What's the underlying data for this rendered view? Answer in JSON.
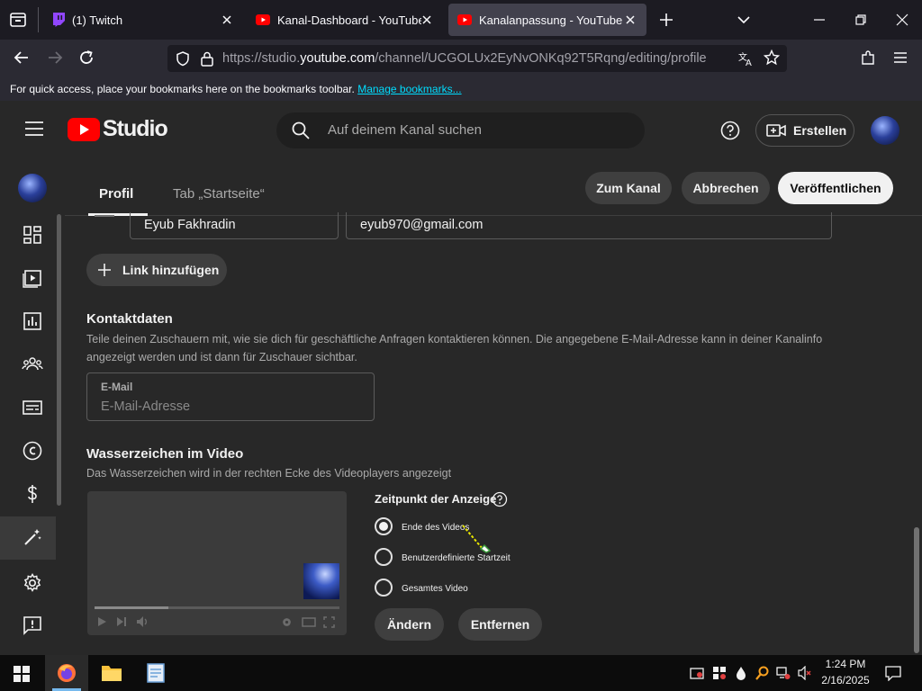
{
  "browser": {
    "tabs": [
      {
        "title": "(1) Twitch",
        "favicon": "twitch-icon",
        "active": false
      },
      {
        "title": "Kanal-Dashboard - YouTube Studio",
        "favicon": "youtube-icon",
        "active": false
      },
      {
        "title": "Kanalanpassung - YouTube Studio",
        "favicon": "youtube-icon",
        "active": true
      }
    ],
    "url_prefix": "https://studio.",
    "url_domain": "youtube.com",
    "url_path": "/channel/UCGOLUx2EyNvONKq92T5Rqng/editing/profile",
    "bookmark_hint": "For quick access, place your bookmarks here on the bookmarks toolbar.",
    "bookmark_link": "Manage bookmarks..."
  },
  "studio": {
    "logo_text": "Studio",
    "search_placeholder": "Auf deinem Kanal suchen",
    "create_label": "Erstellen"
  },
  "page": {
    "tabs": [
      "Profil",
      "Tab „Startseite“"
    ],
    "active_tab": 0,
    "btn_channel": "Zum Kanal",
    "btn_cancel": "Abbrechen",
    "btn_publish": "Veröffentlichen"
  },
  "links": {
    "link_title_value": "Eyub Fakhradin",
    "link_url_value": "eyub970@gmail.com",
    "add_link_label": "Link hinzufügen"
  },
  "contact": {
    "title": "Kontaktdaten",
    "desc": "Teile deinen Zuschauern mit, wie sie dich für geschäftliche Anfragen kontaktieren können. Die angegebene E-Mail-Adresse kann in deiner Kanalinfo angezeigt werden und ist dann für Zuschauer sichtbar.",
    "email_label": "E-Mail",
    "email_placeholder": "E-Mail-Adresse"
  },
  "watermark": {
    "title": "Wasserzeichen im Video",
    "desc": "Das Wasserzeichen wird in der rechten Ecke des Videoplayers angezeigt",
    "display_time_label": "Zeitpunkt der Anzeige",
    "options": [
      "Ende des Videos",
      "Benutzerdefinierte Startzeit",
      "Gesamtes Video"
    ],
    "selected_option": 0,
    "change_label": "Ändern",
    "remove_label": "Entfernen"
  },
  "taskbar": {
    "time": "1:24 PM",
    "date": "2/16/2025"
  },
  "colors": {
    "youtube_red": "#ff0000",
    "studio_bg": "#282828",
    "link_blue": "#00ddff"
  }
}
